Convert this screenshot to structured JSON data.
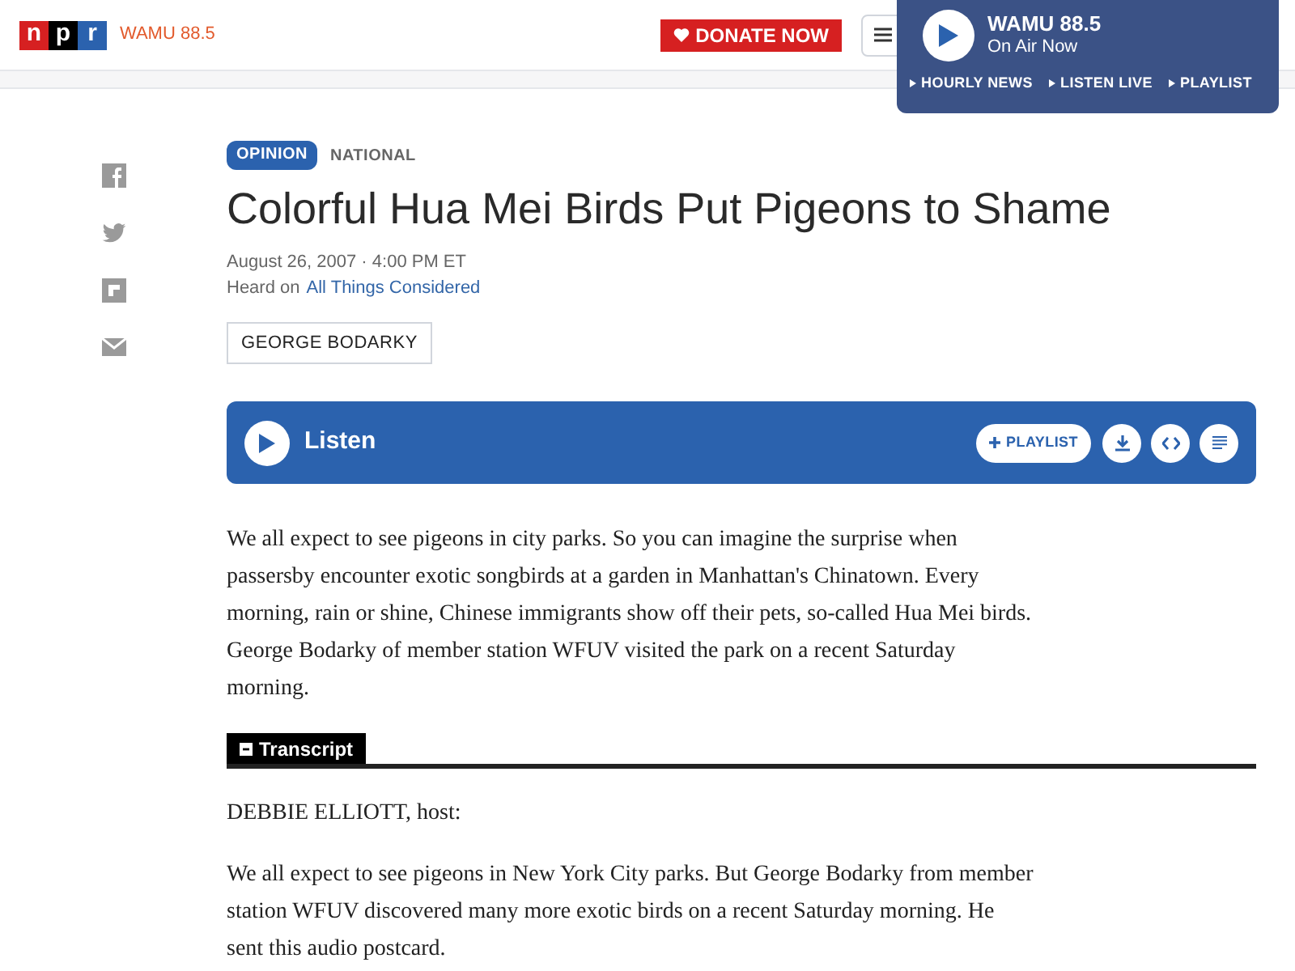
{
  "header": {
    "logo_letters": [
      "n",
      "p",
      "r"
    ],
    "station_logo": "WAMU 88.5",
    "donate_button": "DONATE NOW"
  },
  "player": {
    "station": "WAMU 88.5",
    "status": "On Air Now",
    "links": [
      "HOURLY NEWS",
      "LISTEN LIVE",
      "PLAYLIST"
    ]
  },
  "article": {
    "tags": [
      {
        "label": "OPINION",
        "kind": "badge"
      },
      {
        "label": "NATIONAL",
        "kind": "plain"
      }
    ],
    "title": "Colorful Hua Mei Birds Put Pigeons to Shame",
    "dateline": "August 26, 2007 · 4:00 PM ET",
    "heard_on_label": "Heard on",
    "heard_on_program": "All Things Considered",
    "byline": "GEORGE BODARKY",
    "audio": {
      "label": "Listen",
      "playlist_button": "PLAYLIST"
    },
    "summary": "We all expect to see pigeons in city parks. So you can imagine the surprise when passersby encounter exotic songbirds at a garden in Manhattan's Chinatown. Every morning, rain or shine, Chinese immigrants show off their pets, so-called Hua Mei birds. George Bodarky of member station WFUV visited the park on a recent Saturday morning.",
    "transcript": {
      "label": "Transcript",
      "paragraphs": [
        "DEBBIE ELLIOTT, host:",
        "We all expect to see pigeons in New York City parks. But George Bodarky from member station WFUV discovered many more exotic birds on a recent Saturday morning. He sent this audio postcard."
      ]
    }
  }
}
